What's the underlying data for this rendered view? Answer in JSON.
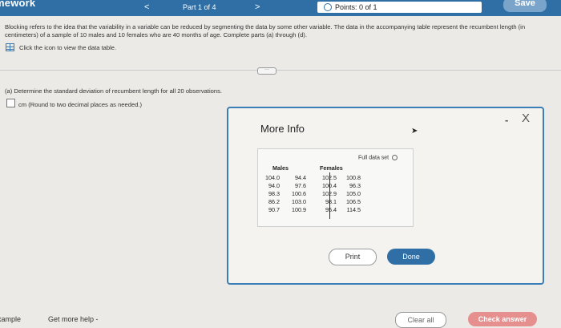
{
  "header": {
    "brand": "mework",
    "part": "Part 1 of 4",
    "nav_prev": "<",
    "nav_next": ">",
    "points": "Points: 0 of 1",
    "save": "Save"
  },
  "problem": {
    "text": "Blocking refers to the idea that the variability in a variable can be reduced by segmenting the data by some other variable. The data in the accompanying table represent the recumbent length (in centimeters) of a sample of 10 males and 10 females who are 40 months of age. Complete parts (a) through (d).",
    "data_link": "Click the icon to view the data table."
  },
  "question": {
    "prompt": "(a) Determine the standard deviation of recumbent length for all 20 observations.",
    "unit_hint": "cm (Round to two decimal places as needed.)"
  },
  "modal": {
    "title": "More Info",
    "minimize": "-",
    "close": "X",
    "full_data_label": "Full data set",
    "headers": {
      "males": "Males",
      "females": "Females"
    },
    "rows": [
      [
        "104.0",
        "94.4",
        "102.5",
        "100.8"
      ],
      [
        "94.0",
        "97.6",
        "100.4",
        "96.3"
      ],
      [
        "98.3",
        "100.6",
        "102.9",
        "105.0"
      ],
      [
        "86.2",
        "103.0",
        "98.1",
        "106.5"
      ],
      [
        "90.7",
        "100.9",
        "95.4",
        "114.5"
      ]
    ],
    "print": "Print",
    "done": "Done"
  },
  "footer": {
    "example": "xample",
    "help": "Get more help -",
    "clear": "Clear all",
    "check": "Check answer"
  }
}
